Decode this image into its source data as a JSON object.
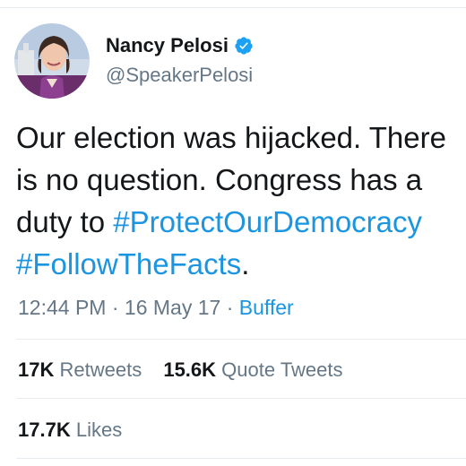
{
  "tweet": {
    "author": {
      "display_name": "Nancy Pelosi",
      "handle": "@SpeakerPelosi",
      "verified": true,
      "avatar_icon": "profile-photo"
    },
    "text_lines": [
      [
        "Our election was hijacked. There"
      ],
      [
        "is no question. Congress has a"
      ],
      [
        "duty to ",
        "#ProtectOurDemocracy"
      ],
      [
        "#FollowTheFacts",
        "."
      ]
    ],
    "time": "12:44 PM",
    "separator": "·",
    "date": "16 May 17",
    "source": "Buffer",
    "stats_row1": [
      {
        "count": "17K",
        "label": "Retweets"
      },
      {
        "count": "15.6K",
        "label": "Quote Tweets"
      }
    ],
    "stats_row2": [
      {
        "count": "17.7K",
        "label": "Likes"
      }
    ]
  },
  "colors": {
    "link": "#1b95e0",
    "secondary_text": "#657786",
    "primary_text": "#14171a",
    "divider": "#e6ecf0",
    "verified_badge": "#1da1f2"
  }
}
